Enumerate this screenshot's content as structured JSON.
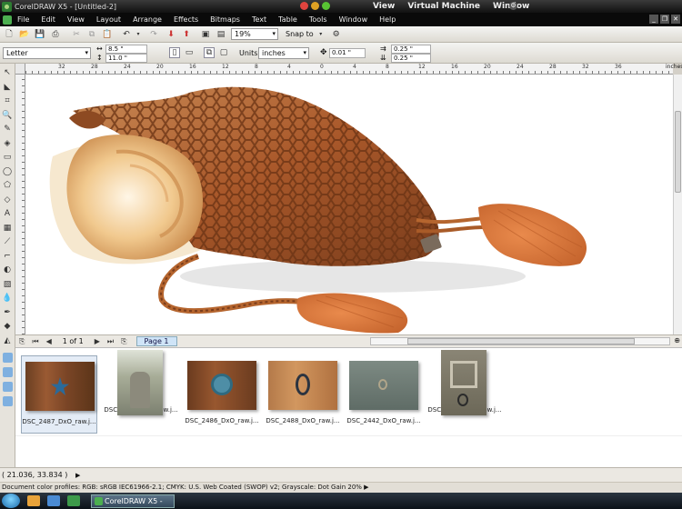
{
  "titlebar": {
    "title": "CorelDRAW X5 - [Untitled-2]",
    "vm_menu": [
      "View",
      "Virtual Machine",
      "Window"
    ]
  },
  "menubar": {
    "items": [
      "File",
      "Edit",
      "View",
      "Layout",
      "Arrange",
      "Effects",
      "Bitmaps",
      "Text",
      "Table",
      "Tools",
      "Window",
      "Help"
    ]
  },
  "standard_toolbar": {
    "zoom": "19%",
    "snap_to": "Snap to"
  },
  "property_bar": {
    "page_size": "Letter",
    "width": "8.5 \"",
    "height": "11.0 \"",
    "units_label": "Units:",
    "units": "inches",
    "nudge": "0.01 \"",
    "dup_x": "0.25 \"",
    "dup_y": "0.25 \""
  },
  "ruler": {
    "ticks": [
      "32",
      "28",
      "24",
      "20",
      "16",
      "12",
      "8",
      "4",
      "0",
      "4",
      "8",
      "12",
      "16",
      "20",
      "24",
      "28",
      "32",
      "36"
    ],
    "unit": "inches"
  },
  "page_nav": {
    "page_of": "1 of 1",
    "page_tab": "Page 1"
  },
  "tray": {
    "items": [
      {
        "caption": "DSC_2487_DxO_raw.j..."
      },
      {
        "caption": "DSC_2652_DxO_raw.j..."
      },
      {
        "caption": "DSC_2486_DxO_raw.j..."
      },
      {
        "caption": "DSC_2488_DxO_raw.j..."
      },
      {
        "caption": "DSC_2442_DxO_raw.j..."
      },
      {
        "caption": "DSC_2512_DxO_raw.j..."
      }
    ]
  },
  "status": {
    "coords": "( 21.036, 33.834 )",
    "profiles": "Document color profiles: RGB: sRGB IEC61966-2.1; CMYK: U.S. Web Coated (SWOP) v2; Grayscale: Dot Gain 20%"
  },
  "taskbar": {
    "task_label": "CorelDRAW X5 - [U..."
  },
  "colors": {
    "shell_brown": "#b5652e",
    "tassel_orange": "#d9773f",
    "shell_cream": "#f3dcb4",
    "selected_tab": "#cfe4f7"
  }
}
